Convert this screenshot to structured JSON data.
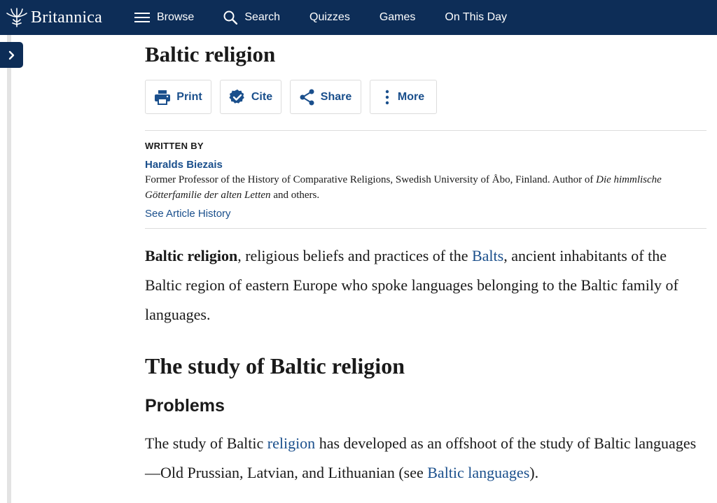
{
  "nav": {
    "logo": "Britannica",
    "browse": "Browse",
    "search": "Search",
    "quizzes": "Quizzes",
    "games": "Games",
    "on_this_day": "On This Day"
  },
  "article": {
    "title": "Baltic religion",
    "actions": {
      "print": "Print",
      "cite": "Cite",
      "share": "Share",
      "more": "More"
    },
    "byline": {
      "written_by": "WRITTEN BY",
      "author": "Haralds Biezais",
      "bio_1": "Former Professor of the History of Comparative Religions, Swedish University of Åbo, Finland. Author of ",
      "bio_book": "Die himmlische Götterfamilie der alten Letten",
      "bio_2": " and others.",
      "history_link": "See Article History"
    },
    "intro": {
      "bold": "Baltic religion",
      "part1": ", religious beliefs and practices of the ",
      "link": "Balts",
      "part2": ", ancient inhabitants of the Baltic region of eastern Europe who spoke languages belonging to the Baltic family of languages."
    },
    "section_heading": "The study of Baltic religion",
    "subsection_heading": "Problems",
    "para": {
      "part1": "The study of Baltic ",
      "link1": "religion",
      "part2": " has developed as an offshoot of the study of Baltic languages—Old Prussian, Latvian, and Lithuanian (see ",
      "link2": "Baltic languages",
      "part3": ")."
    }
  },
  "colors": {
    "nav_bg": "#0d2d57",
    "link": "#1a4f8c"
  }
}
